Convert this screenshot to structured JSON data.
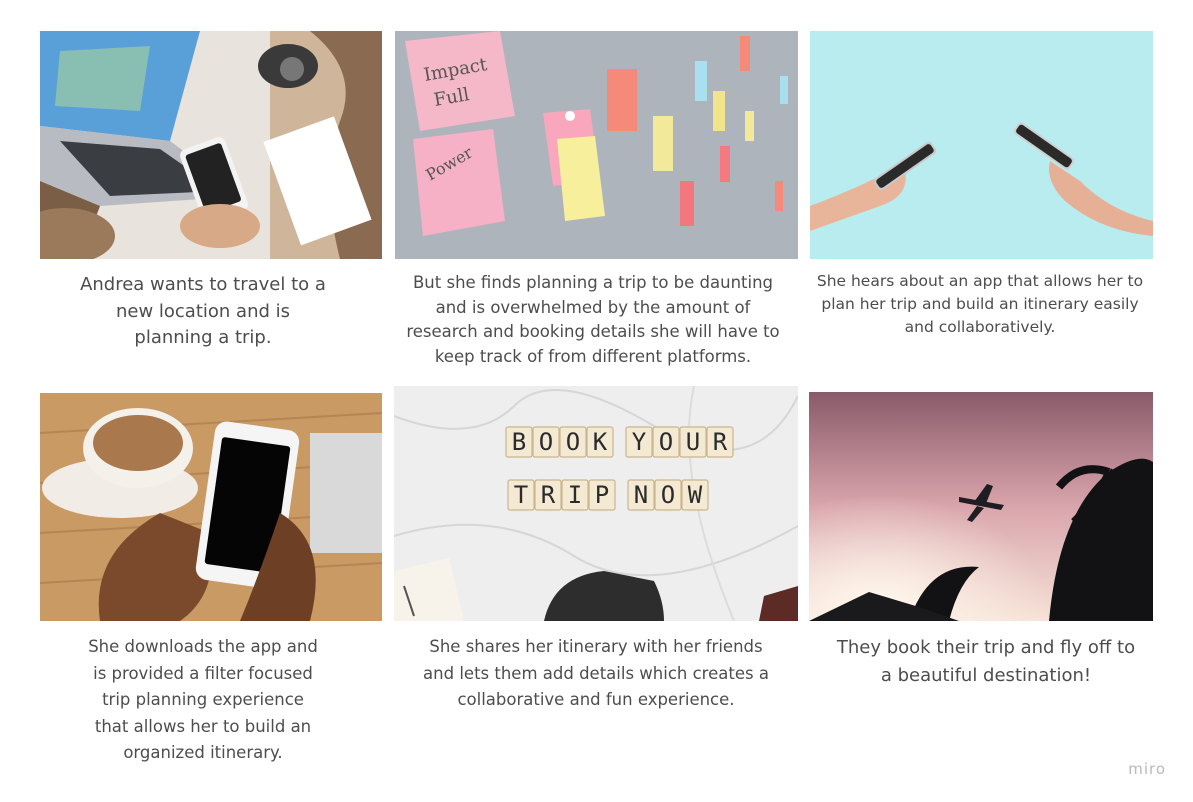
{
  "storyboard": {
    "panels": [
      {
        "image_icon": "travel-planning-desk-photo",
        "caption": [
          "Andrea wants to travel to a",
          "new location and is",
          "planning a trip."
        ]
      },
      {
        "image_icon": "sticky-notes-board-photo",
        "caption": [
          "But she finds planning a trip to be daunting",
          "and is overwhelmed by the amount of",
          "research and booking details she will have to",
          "keep track of from different platforms."
        ]
      },
      {
        "image_icon": "hands-holding-phones-photo",
        "caption": [
          "She hears about an app that allows her to",
          "plan her trip and build an itinerary easily",
          "and collaboratively."
        ]
      },
      {
        "image_icon": "hands-holding-smartphone-photo",
        "caption": [
          "She downloads the app and",
          "is provided a filter focused",
          "trip planning experience",
          "that allows her to build an",
          "organized itinerary."
        ]
      },
      {
        "image_icon": "scrabble-tiles-photo",
        "tiles": {
          "line1": [
            "B",
            "O",
            "O",
            "K",
            "Y",
            "O",
            "U",
            "R"
          ],
          "line2": [
            "T",
            "R",
            "I",
            "P",
            "N",
            "O",
            "W"
          ]
        },
        "caption": [
          "She shares her itinerary with her friends",
          "and lets them add details which creates a",
          "collaborative and fun experience."
        ]
      },
      {
        "image_icon": "airplane-sunset-photo",
        "caption": [
          "They book their trip and fly off to",
          "a beautiful destination!"
        ]
      }
    ]
  },
  "watermark": "miro"
}
